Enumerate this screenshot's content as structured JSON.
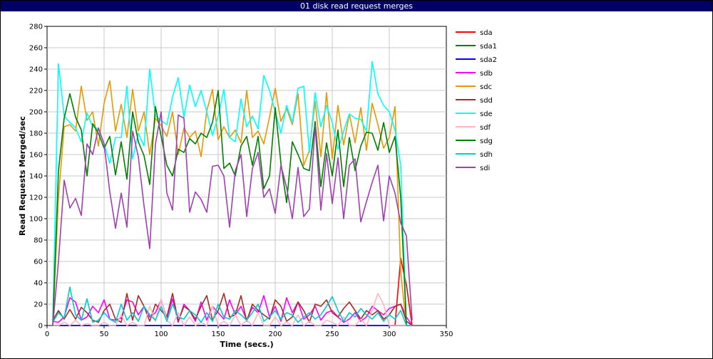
{
  "window": {
    "title": "01 disk read request merges"
  },
  "chart_data": {
    "type": "line",
    "title": "01 disk read request merges",
    "xlabel": "Time (secs.)",
    "ylabel": "Read Requests Merged/sec",
    "xlim": [
      0,
      350
    ],
    "ylim": [
      0,
      280
    ],
    "xticks": [
      0,
      50,
      100,
      150,
      200,
      250,
      300,
      350
    ],
    "yticks": [
      0,
      20,
      40,
      60,
      80,
      100,
      120,
      140,
      160,
      180,
      200,
      220,
      240,
      260,
      280
    ],
    "grid": true,
    "legend_position": "right",
    "x": [
      5,
      10,
      15,
      20,
      25,
      30,
      35,
      40,
      45,
      50,
      55,
      60,
      65,
      70,
      75,
      80,
      85,
      90,
      95,
      100,
      105,
      110,
      115,
      120,
      125,
      130,
      135,
      140,
      145,
      150,
      155,
      160,
      165,
      170,
      175,
      180,
      185,
      190,
      195,
      200,
      205,
      210,
      215,
      220,
      225,
      230,
      235,
      240,
      245,
      250,
      255,
      260,
      265,
      270,
      275,
      280,
      285,
      290,
      295,
      300,
      305,
      310,
      315,
      320
    ],
    "series": [
      {
        "name": "sda",
        "color": "#ff0000",
        "values": [
          0,
          0,
          0,
          0,
          0,
          0,
          0,
          0,
          0,
          0,
          0,
          0,
          0,
          0,
          0,
          0,
          0,
          0,
          0,
          0,
          0,
          0,
          0,
          0,
          0,
          0,
          0,
          0,
          0,
          0,
          0,
          0,
          0,
          0,
          0,
          0,
          0,
          0,
          0,
          0,
          0,
          0,
          0,
          0,
          0,
          0,
          0,
          0,
          0,
          0,
          0,
          0,
          0,
          0,
          0,
          0,
          0,
          0,
          0,
          0,
          0,
          63,
          38,
          0
        ]
      },
      {
        "name": "sda1",
        "color": "#008000",
        "values": [
          0,
          0,
          0,
          0,
          0,
          0,
          0,
          0,
          0,
          0,
          0,
          0,
          0,
          0,
          0,
          0,
          0,
          0,
          0,
          0,
          0,
          0,
          0,
          0,
          0,
          0,
          0,
          0,
          0,
          0,
          0,
          0,
          0,
          0,
          0,
          0,
          0,
          0,
          0,
          0,
          0,
          0,
          0,
          0,
          0,
          0,
          0,
          0,
          0,
          0,
          0,
          0,
          0,
          0,
          0,
          0,
          0,
          0,
          0,
          0,
          0,
          0,
          0,
          0
        ]
      },
      {
        "name": "sda2",
        "color": "#0000ff",
        "values": [
          0,
          0,
          0,
          0,
          0,
          0,
          0,
          0,
          0,
          0,
          0,
          0,
          0,
          0,
          0,
          0,
          0,
          0,
          0,
          0,
          0,
          0,
          0,
          0,
          0,
          0,
          0,
          0,
          0,
          0,
          0,
          0,
          0,
          0,
          0,
          0,
          0,
          0,
          0,
          0,
          0,
          0,
          0,
          0,
          0,
          0,
          0,
          0,
          0,
          0,
          0,
          0,
          0,
          0,
          0,
          0,
          0,
          0,
          0,
          0,
          0,
          0,
          0,
          0
        ]
      },
      {
        "name": "sdb",
        "color": "#ff00ff",
        "values": [
          4,
          3,
          8,
          26,
          22,
          5,
          8,
          18,
          12,
          24,
          6,
          5,
          7,
          24,
          22,
          10,
          18,
          8,
          12,
          24,
          7,
          25,
          3,
          20,
          14,
          4,
          22,
          5,
          18,
          12,
          6,
          24,
          10,
          18,
          5,
          17,
          12,
          28,
          8,
          18,
          4,
          26,
          12,
          22,
          6,
          10,
          18,
          5,
          12,
          14,
          8,
          3,
          6,
          12,
          4,
          8,
          18,
          14,
          10,
          16,
          18,
          20,
          8,
          0
        ]
      },
      {
        "name": "sdc",
        "color": "#e69900",
        "values": [
          0,
          120,
          186,
          188,
          182,
          224,
          192,
          200,
          168,
          208,
          229,
          182,
          207,
          176,
          221,
          182,
          200,
          160,
          194,
          187,
          177,
          200,
          160,
          185,
          176,
          182,
          158,
          201,
          221,
          174,
          186,
          176,
          183,
          171,
          220,
          176,
          182,
          170,
          195,
          222,
          191,
          203,
          188,
          217,
          150,
          164,
          210,
          158,
          218,
          156,
          206,
          169,
          198,
          171,
          204,
          164,
          208,
          188,
          166,
          176,
          205,
          50,
          0,
          0
        ]
      },
      {
        "name": "sdd",
        "color": "#a52a2a",
        "values": [
          5,
          14,
          6,
          15,
          6,
          17,
          12,
          5,
          3,
          14,
          20,
          6,
          3,
          30,
          5,
          28,
          18,
          4,
          20,
          14,
          8,
          30,
          4,
          18,
          14,
          6,
          18,
          28,
          5,
          14,
          30,
          8,
          10,
          28,
          4,
          20,
          14,
          10,
          6,
          24,
          18,
          4,
          8,
          22,
          14,
          3,
          20,
          18,
          24,
          12,
          8,
          16,
          22,
          14,
          6,
          14,
          10,
          14,
          6,
          10,
          18,
          20,
          4,
          0
        ]
      },
      {
        "name": "sde",
        "color": "#00ffff",
        "values": [
          0,
          245,
          196,
          190,
          185,
          172,
          199,
          186,
          184,
          170,
          152,
          176,
          176,
          224,
          156,
          180,
          168,
          240,
          196,
          192,
          188,
          214,
          232,
          195,
          225,
          205,
          220,
          200,
          178,
          196,
          221,
          176,
          172,
          212,
          186,
          196,
          184,
          234,
          220,
          200,
          180,
          206,
          190,
          222,
          224,
          162,
          218,
          186,
          206,
          190,
          165,
          182,
          198,
          194,
          193,
          182,
          247,
          217,
          206,
          200,
          183,
          150,
          0,
          0
        ]
      },
      {
        "name": "sdf",
        "color": "#ffb6c1",
        "values": [
          0,
          0,
          3,
          0,
          5,
          0,
          2,
          0,
          0,
          3,
          0,
          0,
          10,
          0,
          3,
          0,
          0,
          18,
          4,
          25,
          5,
          0,
          12,
          0,
          8,
          0,
          3,
          0,
          18,
          0,
          4,
          0,
          10,
          0,
          5,
          0,
          12,
          0,
          0,
          8,
          0,
          3,
          0,
          10,
          0,
          4,
          0,
          0,
          5,
          3,
          0,
          8,
          0,
          0,
          6,
          0,
          14,
          30,
          20,
          0,
          0,
          0,
          0,
          0
        ]
      },
      {
        "name": "sdg",
        "color": "#008000",
        "values": [
          0,
          145,
          194,
          217,
          195,
          183,
          140,
          189,
          180,
          166,
          177,
          141,
          172,
          137,
          200,
          172,
          159,
          132,
          205,
          177,
          150,
          140,
          165,
          162,
          175,
          170,
          180,
          176,
          190,
          220,
          147,
          152,
          140,
          168,
          177,
          150,
          177,
          128,
          140,
          204,
          152,
          115,
          172,
          160,
          147,
          145,
          191,
          130,
          171,
          140,
          183,
          130,
          176,
          145,
          168,
          181,
          180,
          164,
          190,
          162,
          177,
          120,
          0,
          0
        ]
      },
      {
        "name": "sdh",
        "color": "#00cccc",
        "values": [
          3,
          12,
          7,
          36,
          10,
          5,
          25,
          3,
          5,
          12,
          6,
          3,
          20,
          5,
          12,
          4,
          18,
          10,
          5,
          18,
          4,
          20,
          8,
          6,
          14,
          10,
          3,
          12,
          4,
          20,
          8,
          6,
          14,
          10,
          5,
          12,
          20,
          4,
          8,
          14,
          6,
          12,
          10,
          3,
          8,
          12,
          6,
          10,
          18,
          27,
          14,
          4,
          12,
          8,
          16,
          10,
          6,
          12,
          4,
          10,
          6,
          14,
          0,
          0
        ]
      },
      {
        "name": "sdi",
        "color": "#a040b0",
        "values": [
          0,
          60,
          136,
          110,
          119,
          103,
          170,
          160,
          185,
          170,
          125,
          91,
          124,
          92,
          182,
          158,
          112,
          72,
          170,
          200,
          124,
          108,
          197,
          194,
          106,
          125,
          118,
          106,
          149,
          150,
          140,
          92,
          145,
          160,
          102,
          147,
          162,
          120,
          128,
          105,
          150,
          129,
          100,
          148,
          102,
          109,
          187,
          108,
          161,
          114,
          157,
          100,
          150,
          156,
          97,
          116,
          134,
          150,
          98,
          140,
          124,
          96,
          84,
          5
        ]
      }
    ]
  }
}
